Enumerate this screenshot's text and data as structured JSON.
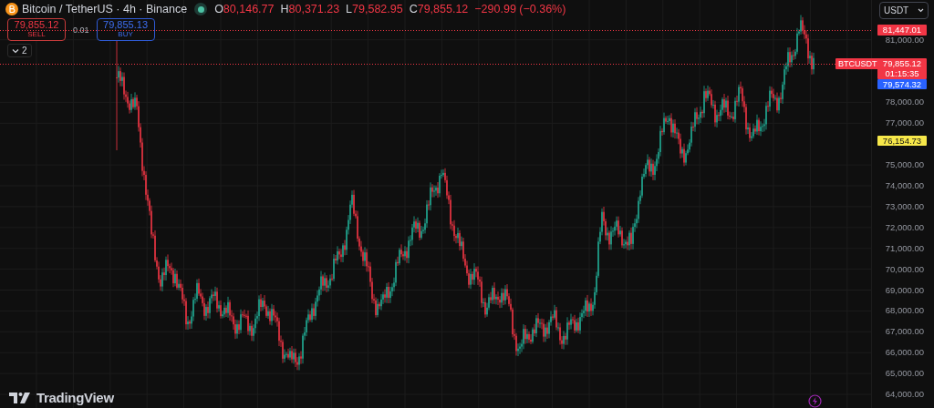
{
  "header": {
    "symbol": "Bitcoin / TetherUS · 4h · Binance",
    "market_open": true,
    "ohlc": [
      {
        "label": "O",
        "value": "80,146.77"
      },
      {
        "label": "H",
        "value": "80,371.23"
      },
      {
        "label": "L",
        "value": "79,582.95"
      },
      {
        "label": "C",
        "value": "79,855.12"
      }
    ],
    "change": "−290.99 (−0.36%)"
  },
  "trade": {
    "sell": {
      "price": "79,855.12",
      "label": "SELL"
    },
    "quantity": "0.01",
    "buy": {
      "price": "79,855.13",
      "label": "BUY"
    }
  },
  "indicators_toggle": {
    "count": "2"
  },
  "currency": "USDT",
  "price_axis": [
    "81,000.00",
    "78,000.00",
    "77,000.00",
    "75,000.00",
    "74,000.00",
    "73,000.00",
    "72,000.00",
    "71,000.00",
    "70,000.00",
    "69,000.00",
    "68,000.00",
    "67,000.00",
    "66,000.00",
    "65,000.00",
    "64,000.00"
  ],
  "price_tags": [
    {
      "text": "81,447.01",
      "color": "#f23645",
      "line": true
    },
    {
      "text": "79,855.12",
      "countdown": "01:15:35",
      "symbol": "BTCUSDT",
      "color": "#f23645",
      "line": true
    },
    {
      "text": "79,574.32",
      "color": "#2962ff",
      "line": false
    },
    {
      "text": "76,154.73",
      "color": "#f7e84a",
      "line": false
    }
  ],
  "logo": "TradingView"
}
